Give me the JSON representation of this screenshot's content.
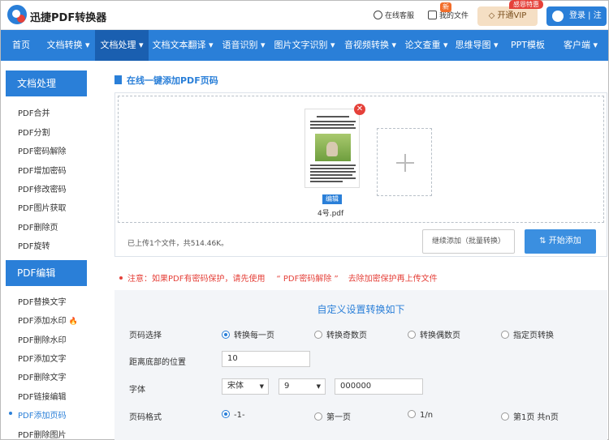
{
  "header": {
    "brand": "迅捷PDF转换器",
    "service": "在线客服",
    "my_files": "我的文件",
    "vip_tag": "感恩特惠",
    "vip": "开通VIP",
    "login": "登录 | 注册"
  },
  "nav": {
    "items": [
      "首页",
      "文档转换 ▾",
      "文档处理 ▾",
      "文档文本翻译 ▾",
      "语音识别 ▾",
      "图片文字识别 ▾",
      "音视频转换 ▾",
      "论文查重 ▾",
      "思维导图 ▾",
      "PPT模板",
      "客户端 ▾"
    ],
    "badge": "新"
  },
  "sidebar": {
    "group1": "文档处理",
    "items1": [
      "PDF合并",
      "PDF分割",
      "PDF密码解除",
      "PDF增加密码",
      "PDF修改密码",
      "PDF图片获取",
      "PDF删除页",
      "PDF旋转"
    ],
    "group2": "PDF编辑",
    "items2": [
      "PDF替换文字",
      "PDF添加水印",
      "PDF删除水印",
      "PDF添加文字",
      "PDF删除文字",
      "PDF链接编辑",
      "PDF添加页码",
      "PDF删除图片"
    ],
    "flame": "🔥"
  },
  "main": {
    "title": "在线一键添加PDF页码",
    "close": "✕",
    "edit": "编辑",
    "file_name": "4号.pdf",
    "info": "已上传1个文件，共514.46K。",
    "continue_btn": "继续添加（批量转换）",
    "start_btn": "⇅  开始添加",
    "notice_a": "注意：如果PDF有密码保护，请先使用",
    "notice_q": "“ PDF密码解除 ”",
    "notice_b": "去除加密保护再上传文件"
  },
  "settings": {
    "title": "自定义设置转换如下",
    "page_select_label": "页码选择",
    "page_opts": [
      "转换每一页",
      "转换奇数页",
      "转换偶数页",
      "指定页转换"
    ],
    "bottom_dist_label": "距离底部的位置",
    "bottom_dist_value": "10",
    "font_label": "字体",
    "font_value": "宋体",
    "font_size": "9",
    "font_color": "000000",
    "format_label": "页码格式",
    "format_opts": [
      "-1-",
      "第一页",
      "1/n",
      "第1页 共n页"
    ]
  }
}
